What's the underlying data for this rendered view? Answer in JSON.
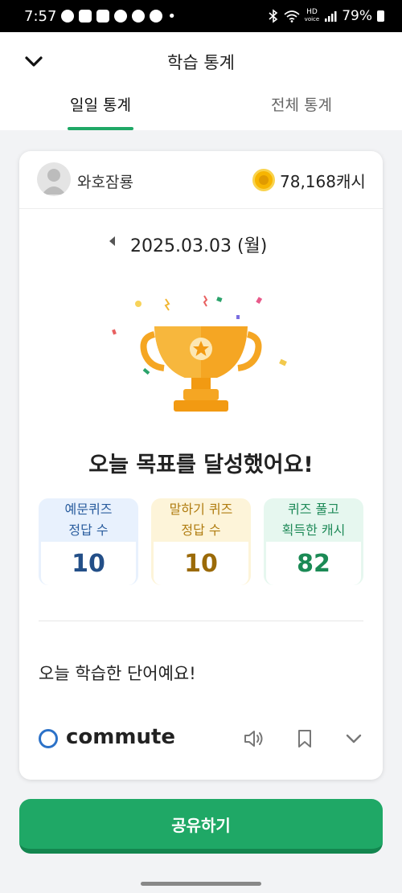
{
  "status_bar": {
    "time": "7:57",
    "dot": "•",
    "hd_top": "HD",
    "hd_bottom": "voice",
    "battery_percent": "79%"
  },
  "header": {
    "title": "학습 통계",
    "tabs": [
      {
        "label": "일일 통계",
        "active": true
      },
      {
        "label": "전체 통계",
        "active": false
      }
    ]
  },
  "user": {
    "name": "와호잠룡",
    "cash": "78,168캐시"
  },
  "date": "2025.03.03 (월)",
  "goal_message": "오늘 목표를 달성했어요!",
  "stats": [
    {
      "line1": "예문퀴즈",
      "line2": "정답 수",
      "value": "10",
      "color": "#234f88"
    },
    {
      "line1": "말하기 퀴즈",
      "line2": "정답 수",
      "value": "10",
      "color": "#9b6a08"
    },
    {
      "line1": "퀴즈 풀고",
      "line2": "획득한 캐시",
      "value": "82",
      "color": "#1b8a55"
    }
  ],
  "words_heading": "오늘 학습한 단어예요!",
  "words": [
    {
      "text": "commute"
    }
  ],
  "share_button": "공유하기",
  "colors": {
    "accent_green": "#1fa866",
    "word_mark_blue": "#2c72c8",
    "trophy_orange": "#f5a623"
  },
  "icons": [
    "back-chevron-icon",
    "coin-icon",
    "prev-date-icon",
    "trophy-icon",
    "speaker-icon",
    "bookmark-icon",
    "chevron-down-icon"
  ]
}
